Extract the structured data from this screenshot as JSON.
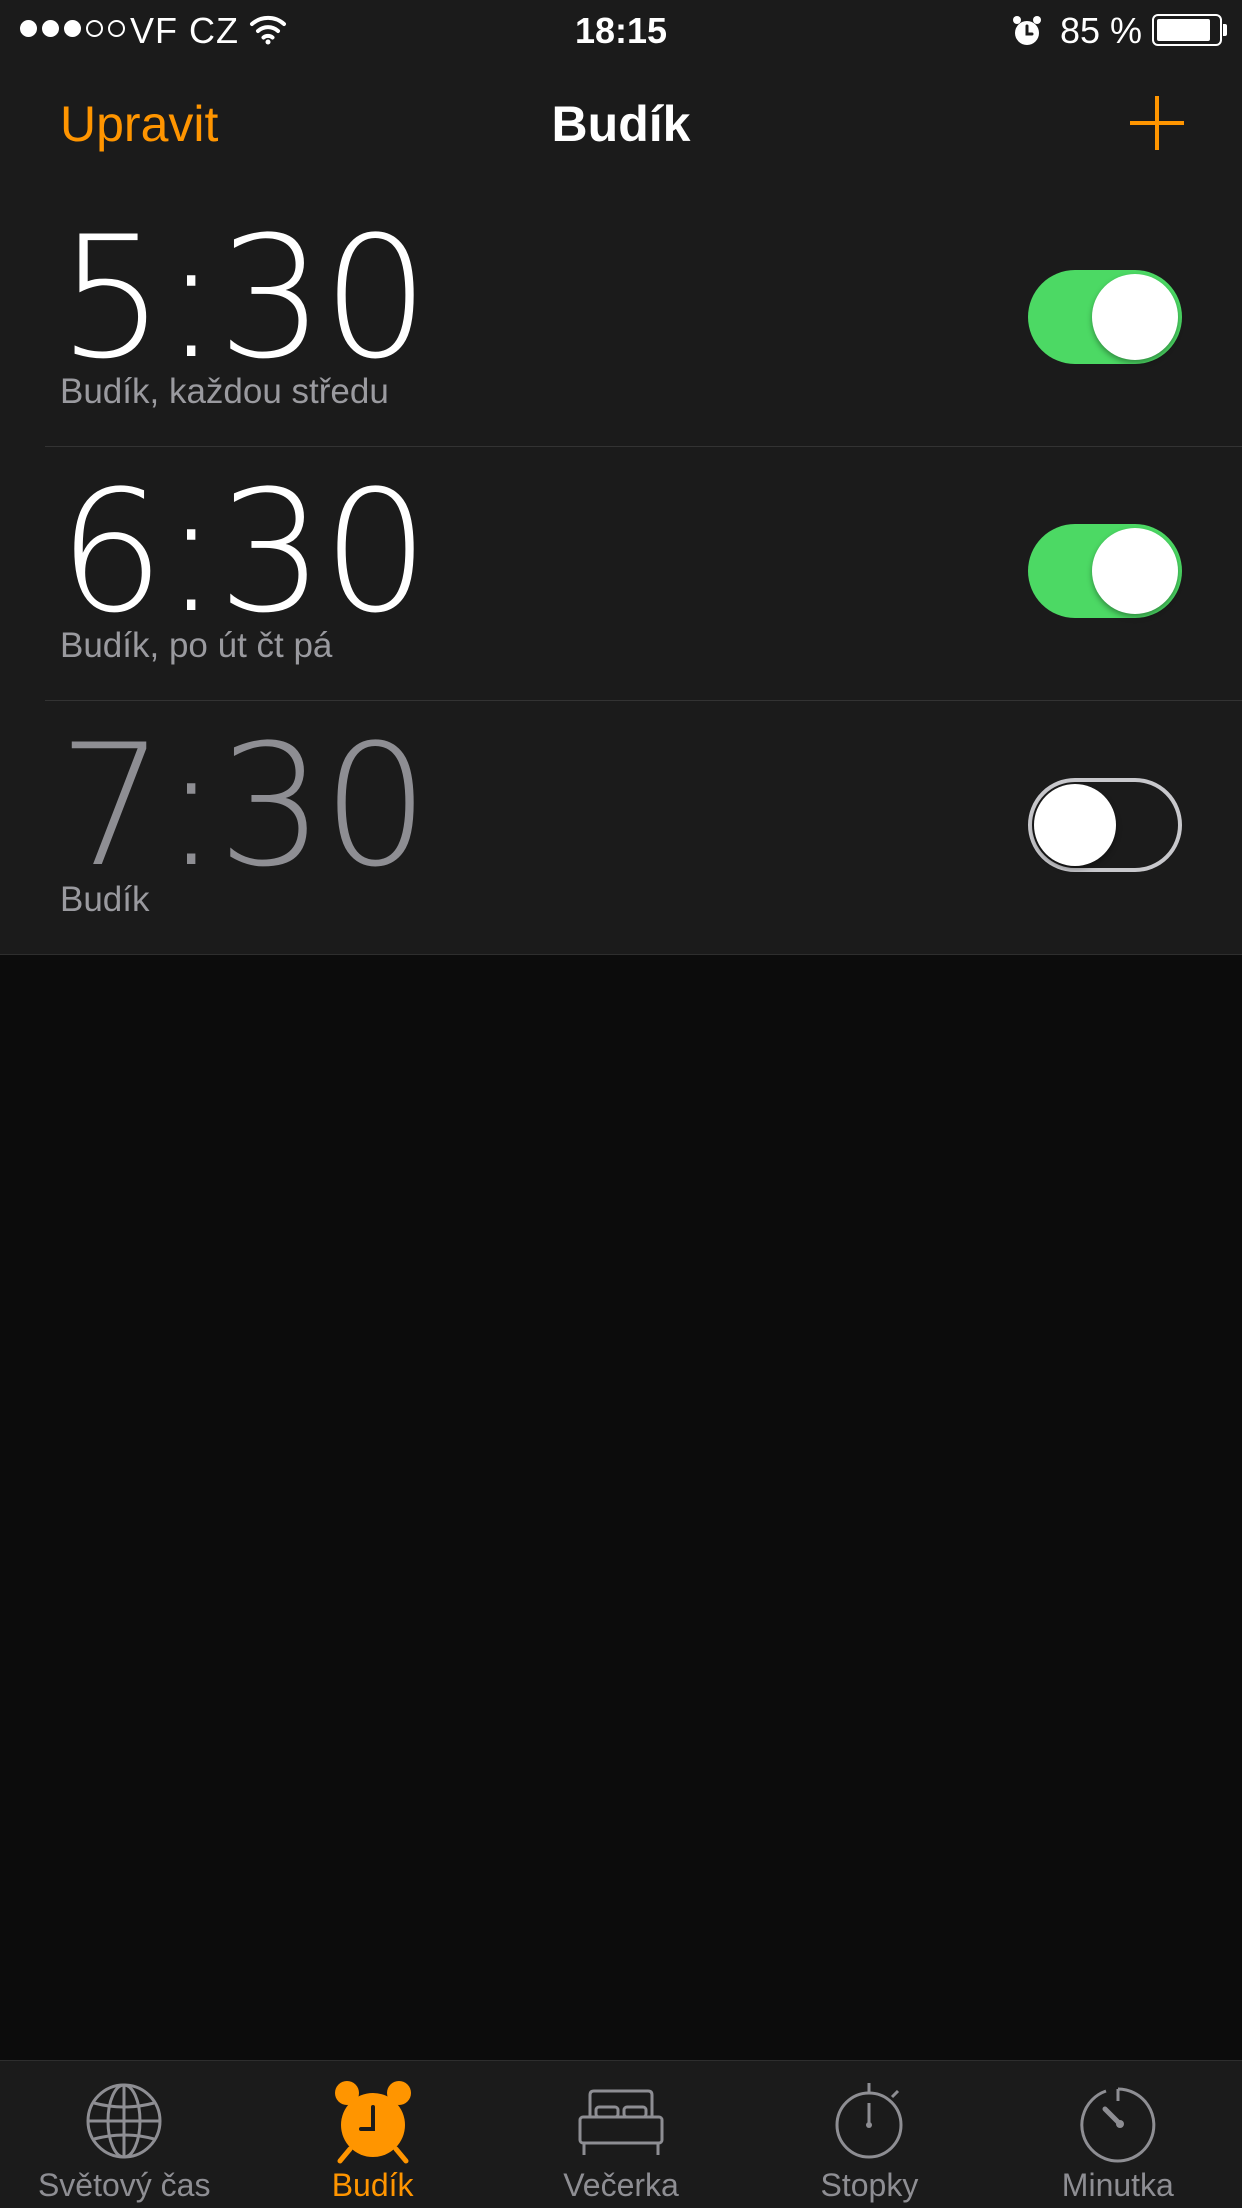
{
  "status_bar": {
    "signal_dots": [
      true,
      true,
      true,
      false,
      false
    ],
    "carrier": "VF CZ",
    "wifi_icon": "wifi-icon",
    "time": "18:15",
    "alarm_icon": "alarm-clock-icon",
    "battery_percent": "85 %",
    "battery_level": 0.85
  },
  "nav": {
    "edit_label": "Upravit",
    "title": "Budík",
    "add_icon": "plus-icon"
  },
  "alarms": [
    {
      "time": "5:30",
      "label": "Budík, každou středu",
      "enabled": true
    },
    {
      "time": "6:30",
      "label": "Budík, po út čt pá",
      "enabled": true
    },
    {
      "time": "7:30",
      "label": "Budík",
      "enabled": false
    }
  ],
  "tabs": [
    {
      "label": "Světový čas",
      "icon": "globe-icon",
      "active": false
    },
    {
      "label": "Budík",
      "icon": "alarm-clock-icon",
      "active": true
    },
    {
      "label": "Večerka",
      "icon": "bed-icon",
      "active": false
    },
    {
      "label": "Stopky",
      "icon": "stopwatch-icon",
      "active": false
    },
    {
      "label": "Minutka",
      "icon": "timer-icon",
      "active": false
    }
  ],
  "colors": {
    "accent": "#ff9500",
    "toggle_on": "#4cd964",
    "background": "#0c0c0c",
    "bar_background": "#1b1b1b",
    "inactive_tab": "#8e8e93"
  }
}
